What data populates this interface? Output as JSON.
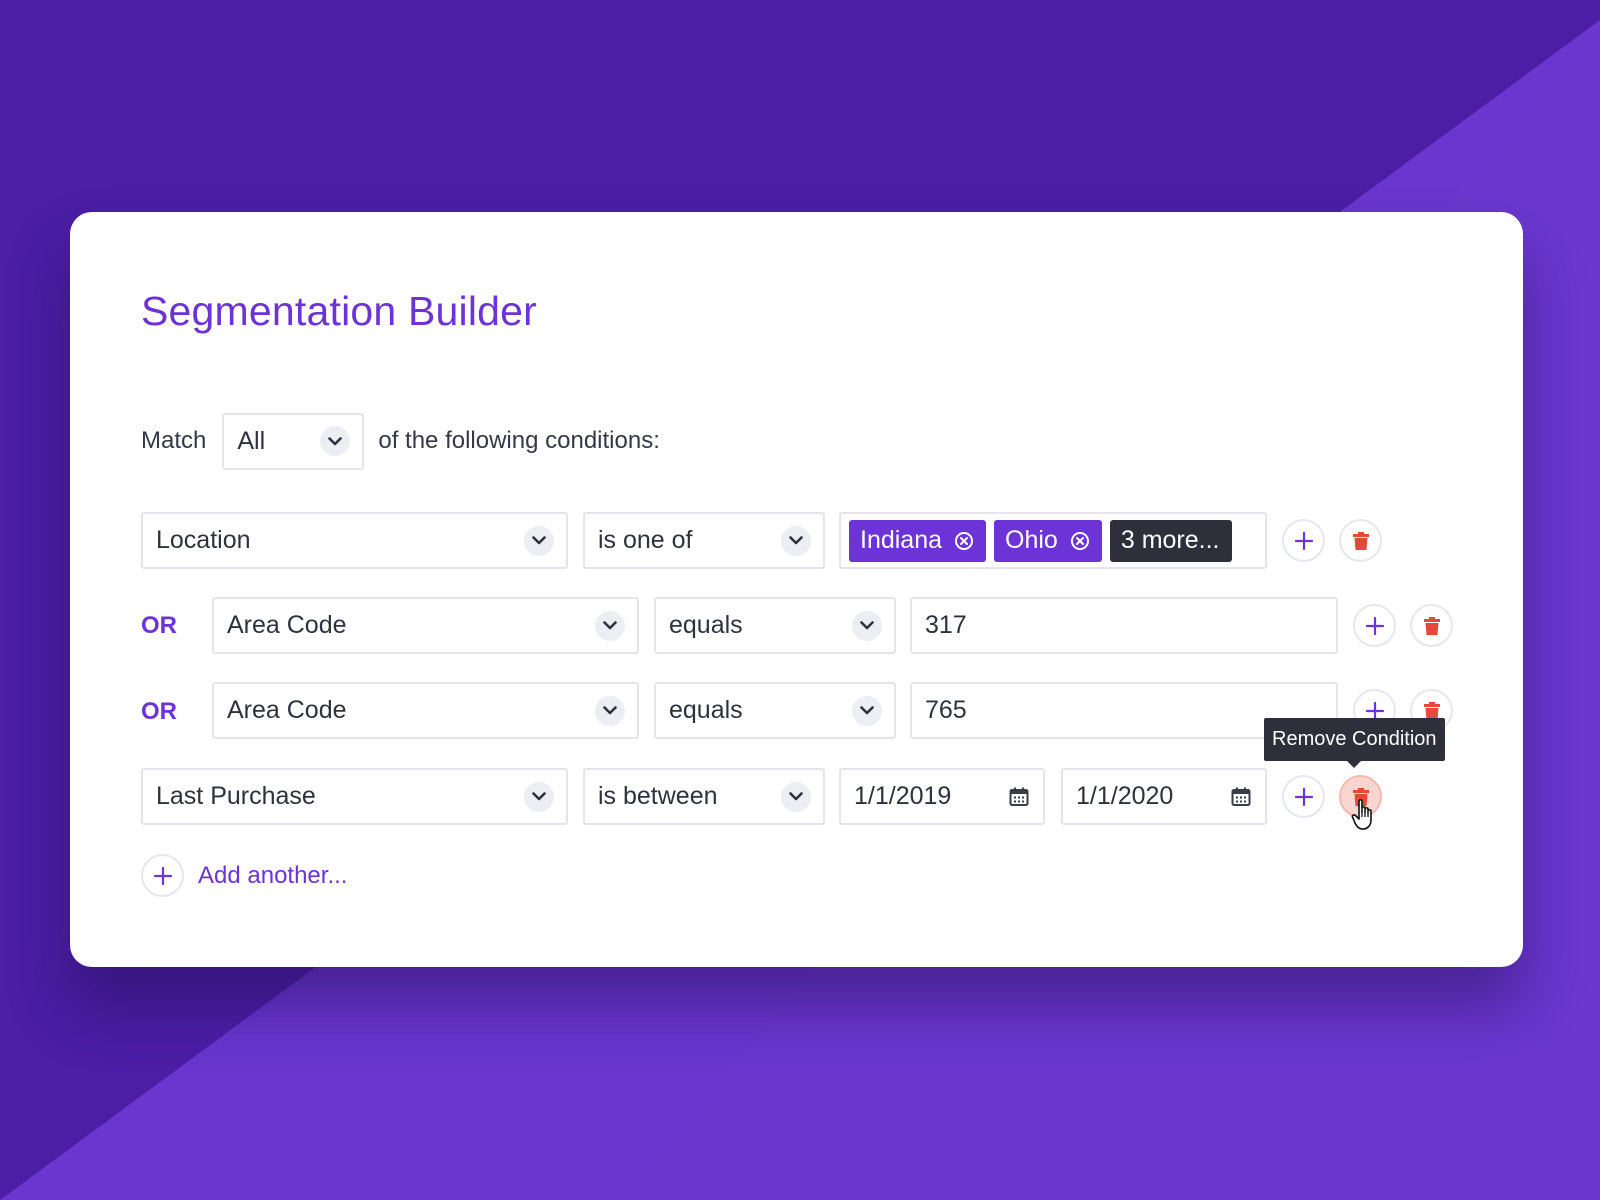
{
  "title": "Segmentation Builder",
  "match": {
    "prefix": "Match",
    "value": "All",
    "suffix": "of the following conditions:"
  },
  "rows": [
    {
      "connector": "",
      "field": "Location",
      "operator": "is one of",
      "tags": [
        "Indiana",
        "Ohio"
      ],
      "more": "3 more..."
    },
    {
      "connector": "OR",
      "field": "Area Code",
      "operator": "equals",
      "value": "317"
    },
    {
      "connector": "OR",
      "field": "Area Code",
      "operator": "equals",
      "value": "765"
    },
    {
      "connector": "",
      "field": "Last Purchase",
      "operator": "is between",
      "from": "1/1/2019",
      "to": "1/1/2020"
    }
  ],
  "tooltip": "Remove Condition",
  "add_another": "Add another...",
  "colors": {
    "accent": "#6c33d6",
    "danger": "#e8483a",
    "background": "#4b1ea5",
    "dark_tag": "#2e2f3a"
  },
  "icons": {
    "dropdown": "chevron-down-icon",
    "add": "plus-icon",
    "remove": "trash-icon",
    "date": "calendar-icon",
    "tag_remove": "close-circle-icon",
    "pointer": "hand-cursor-icon"
  }
}
